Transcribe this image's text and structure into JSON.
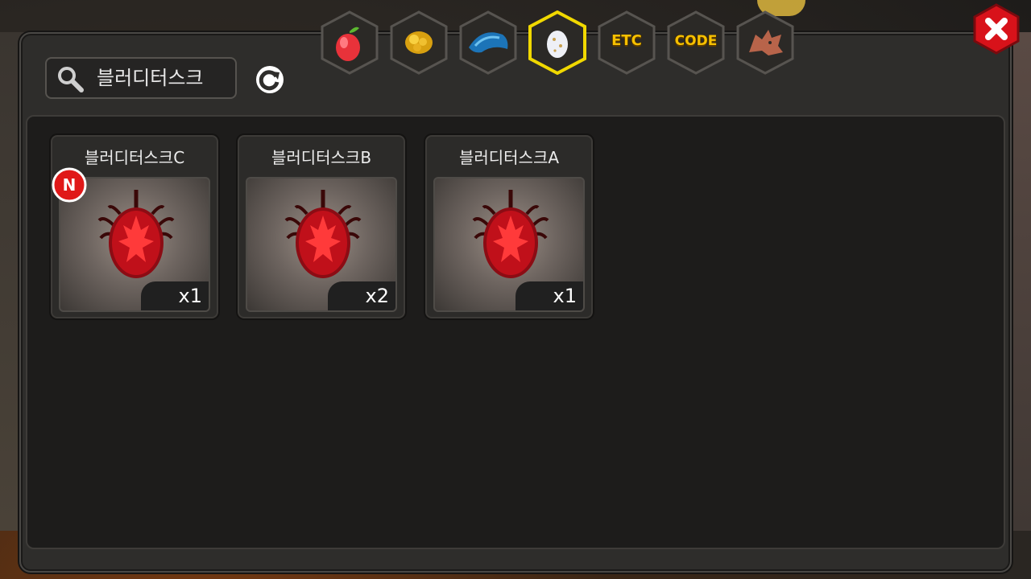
{
  "search": {
    "query": "블러디터스크"
  },
  "tabs": [
    {
      "name": "fruit",
      "icon": "red-fruit-icon",
      "active": false
    },
    {
      "name": "gold",
      "icon": "gold-nugget-icon",
      "active": false
    },
    {
      "name": "fish",
      "icon": "blue-fish-icon",
      "active": false
    },
    {
      "name": "egg",
      "icon": "egg-icon",
      "active": true
    },
    {
      "name": "etc",
      "label": "ETC",
      "active": false
    },
    {
      "name": "code",
      "label": "CODE",
      "active": false
    },
    {
      "name": "dragon",
      "icon": "dragon-head-icon",
      "active": false
    }
  ],
  "items": [
    {
      "name": "블러디터스크C",
      "quantity": "x1",
      "new_badge": "N",
      "is_new": true
    },
    {
      "name": "블러디터스크B",
      "quantity": "x2",
      "is_new": false
    },
    {
      "name": "블러디터스크A",
      "quantity": "x1",
      "is_new": false
    }
  ],
  "colors": {
    "tab_active_border": "#f0d800",
    "tab_label": "#f6c000",
    "close_button": "#d8121a",
    "egg_red": "#c0101a",
    "new_badge": "#e01818"
  }
}
